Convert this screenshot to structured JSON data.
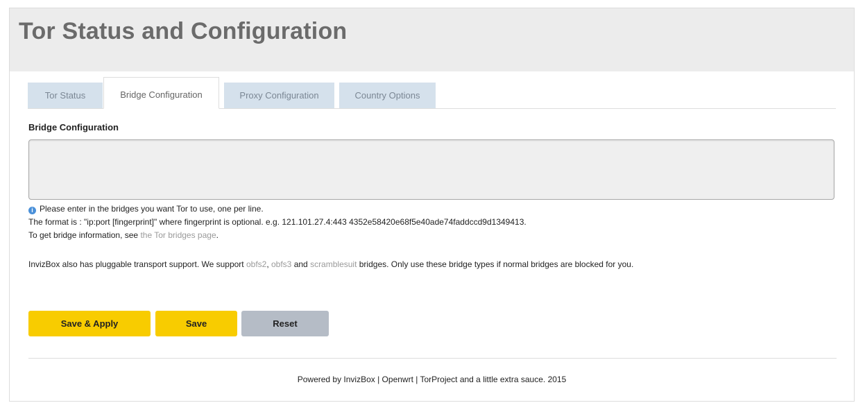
{
  "header": {
    "title": "Tor Status and Configuration"
  },
  "tabs": [
    {
      "label": "Tor Status",
      "active": false
    },
    {
      "label": "Bridge Configuration",
      "active": true
    },
    {
      "label": "Proxy Configuration",
      "active": false
    },
    {
      "label": "Country Options",
      "active": false
    }
  ],
  "bridge": {
    "section_title": "Bridge Configuration",
    "input_value": "",
    "help_line1": "Please enter in the bridges you want Tor to use, one per line.",
    "help_line2": "The format is : \"ip:port [fingerprint]\" where fingerprint is optional. e.g. 121.101.27.4:443 4352e58420e68f5e40ade74faddccd9d1349413.",
    "help_line3_prefix": "To get bridge information, see ",
    "help_line3_link": "the Tor bridges page",
    "help_line3_suffix": "."
  },
  "pluggable": {
    "prefix": "InvizBox also has pluggable transport support. We support ",
    "link1": "obfs2",
    "sep1": ", ",
    "link2": "obfs3",
    "sep2": " and ",
    "link3": "scramblesuit",
    "suffix": " bridges. Only use these bridge types if normal bridges are blocked for you."
  },
  "buttons": {
    "save_apply": "Save & Apply",
    "save": "Save",
    "reset": "Reset"
  },
  "footer": {
    "text": "Powered by InvizBox | Openwrt | TorProject and a little extra sauce. 2015"
  },
  "colors": {
    "accent_yellow": "#f8cc00",
    "reset_gray": "#b5bcc6",
    "tab_inactive": "#d5e1ec",
    "info_icon": "#4a90d9"
  },
  "icons": {
    "help": "info-icon"
  }
}
